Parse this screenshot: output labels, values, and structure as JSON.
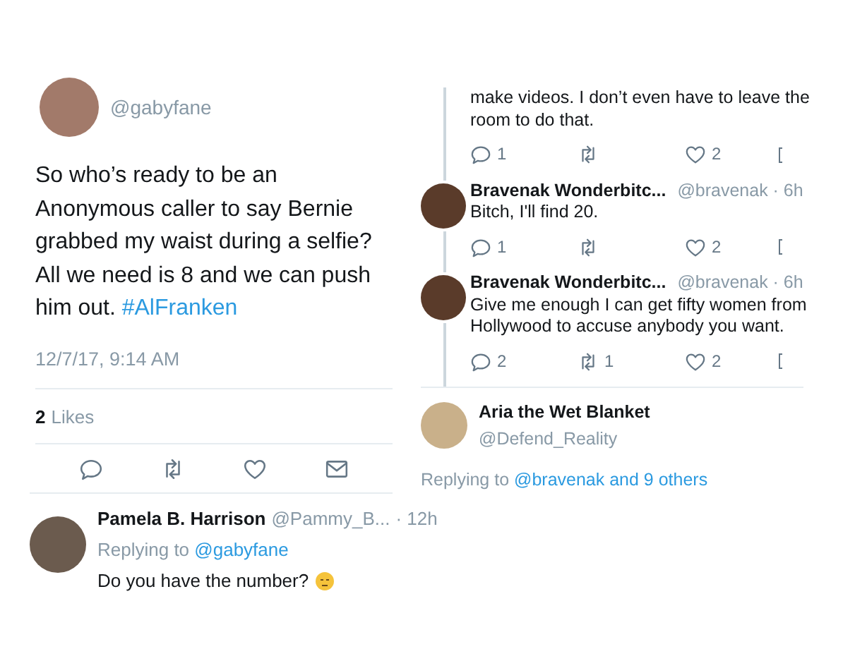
{
  "left_tweet": {
    "handle": "@gabyfane",
    "text": "So who’s ready to be an Anonymous caller to say Bernie grabbed my waist during a selfie? All we need is 8 and we can push him out.",
    "hashtag": "#AlFranken",
    "timestamp": "12/7/17, 9:14 AM",
    "likes_count": "2",
    "likes_label": "Likes"
  },
  "left_reply": {
    "name": "Pamela B. Harrison",
    "handle": "@Pammy_B...",
    "time": "· 12h",
    "replying_label": "Replying to",
    "replying_to": "@gabyfane",
    "text": "Do you have the number?"
  },
  "thread": [
    {
      "kind": "continuation",
      "text": "make videos. I don’t even have to leave the room to do that.",
      "replies": "1",
      "likes": "2"
    },
    {
      "kind": "reply",
      "name": "Bravenak Wonderbitc...",
      "handle": "@bravenak · 6h",
      "text": "Bitch, I'll find 20.",
      "replies": "1",
      "likes": "2"
    },
    {
      "kind": "reply",
      "name": "Bravenak Wonderbitc...",
      "handle": "@bravenak · 6h",
      "text": "Give me enough I can get fifty women from Hollywood to accuse anybody you want.",
      "replies": "2",
      "retweets": "1",
      "likes": "2"
    }
  ],
  "last_reply": {
    "name": "Aria the Wet Blanket",
    "handle": "@Defend_Reality",
    "replying_label": "Replying to",
    "replying_to": "@bravenak and 9 others"
  }
}
